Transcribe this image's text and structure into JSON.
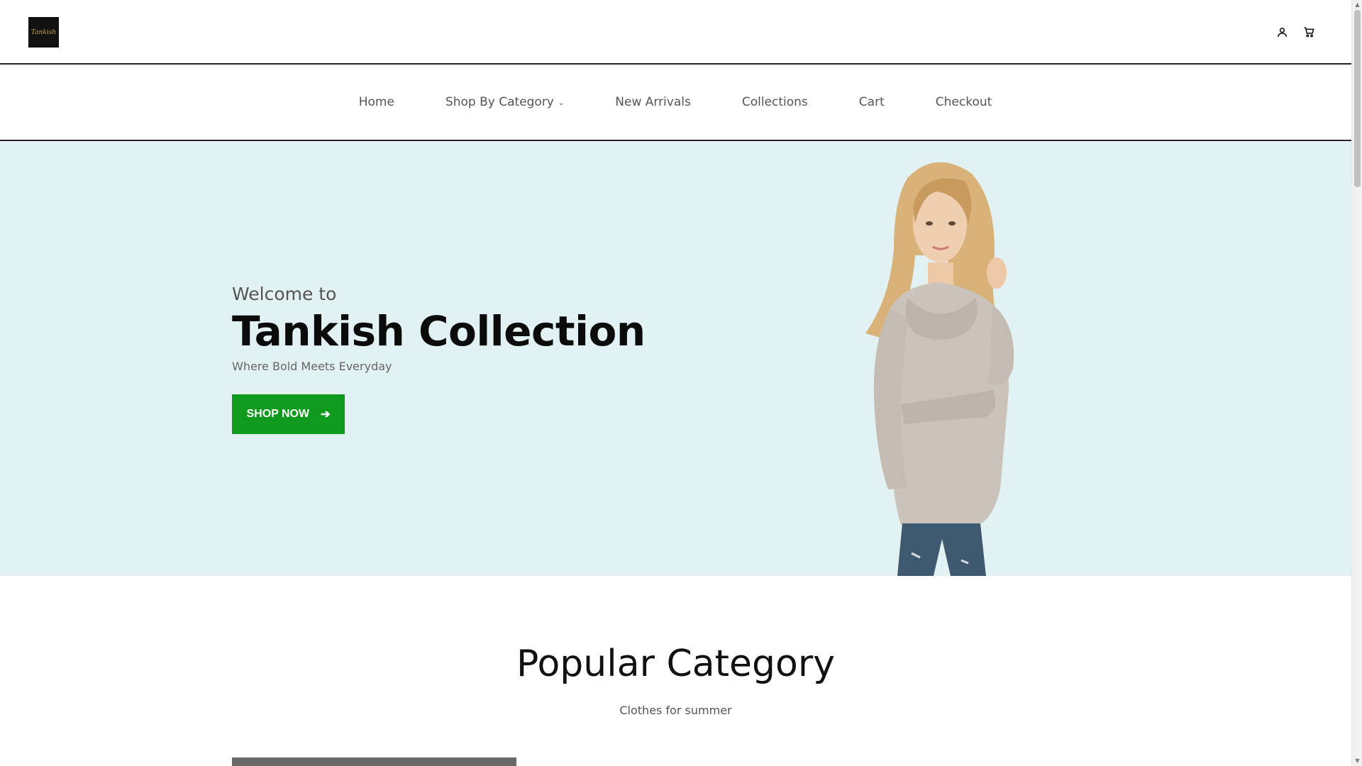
{
  "brand": {
    "logo_text": "Tankish",
    "logo_bg": "#111111",
    "logo_accent": "#c9a24a"
  },
  "header": {
    "icons": [
      "account-icon",
      "cart-icon"
    ]
  },
  "nav": {
    "items": [
      {
        "label": "Home"
      },
      {
        "label": "Shop By Category",
        "has_dropdown": true
      },
      {
        "label": "New Arrivals"
      },
      {
        "label": "Collections"
      },
      {
        "label": "Cart"
      },
      {
        "label": "Checkout"
      }
    ]
  },
  "hero": {
    "welcome": "Welcome to",
    "title": "Tankish Collection",
    "tagline": "Where Bold Meets Everyday",
    "cta_label": "SHOP NOW",
    "cta_icon": "arrow-right-icon",
    "bg_color": "#e2f1f1",
    "cta_color": "#0e9a1d"
  },
  "popular": {
    "title": "Popular Category",
    "subtitle": "Clothes for summer"
  }
}
